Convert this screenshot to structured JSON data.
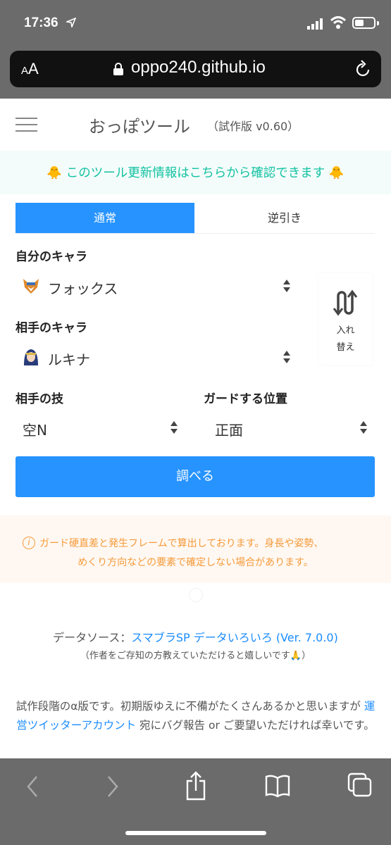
{
  "status": {
    "time": "17:36"
  },
  "browser": {
    "aa_label": "AA",
    "url": "oppo240.github.io"
  },
  "header": {
    "title": "おっぽツール",
    "version": "（試作版 v0.60）"
  },
  "notice": {
    "text": "🐥 このツール更新情報はこちらから確認できます 🐥"
  },
  "tabs": [
    {
      "label": "通常",
      "active": true
    },
    {
      "label": "逆引き",
      "active": false
    }
  ],
  "form": {
    "my_char_label": "自分のキャラ",
    "my_char_value": "フォックス",
    "opp_char_label": "相手のキャラ",
    "opp_char_value": "ルキナ",
    "swap_label_1": "入れ",
    "swap_label_2": "替え",
    "move_label": "相手の技",
    "move_value": "空N",
    "guard_label": "ガードする位置",
    "guard_value": "正面",
    "search_button": "調べる"
  },
  "warning": {
    "line1": "ガード硬直差と発生フレームで算出しております。身長や姿勢、",
    "line2": "めくり方向などの要素で確定しない場合があります。"
  },
  "footer": {
    "data_source_prefix": "データソース：",
    "data_source_link": "スマブラSP データいろいろ (Ver. 7.0.0)",
    "author_note": "（作者をご存知の方教えていただけると嬉しいです🙏）",
    "alpha_text_1": "試作段階のα版です。初期版ゆえに不備がたくさんあるかと思いますが ",
    "alpha_link": "運営ツイッターアカウント",
    "alpha_text_2": " 宛にバグ報告 or ご要望いただければ幸いです。"
  },
  "colors": {
    "accent": "#2693ff",
    "notice_text": "#13c2a3",
    "warning_text": "#f59a3a",
    "link": "#1a8cff"
  }
}
